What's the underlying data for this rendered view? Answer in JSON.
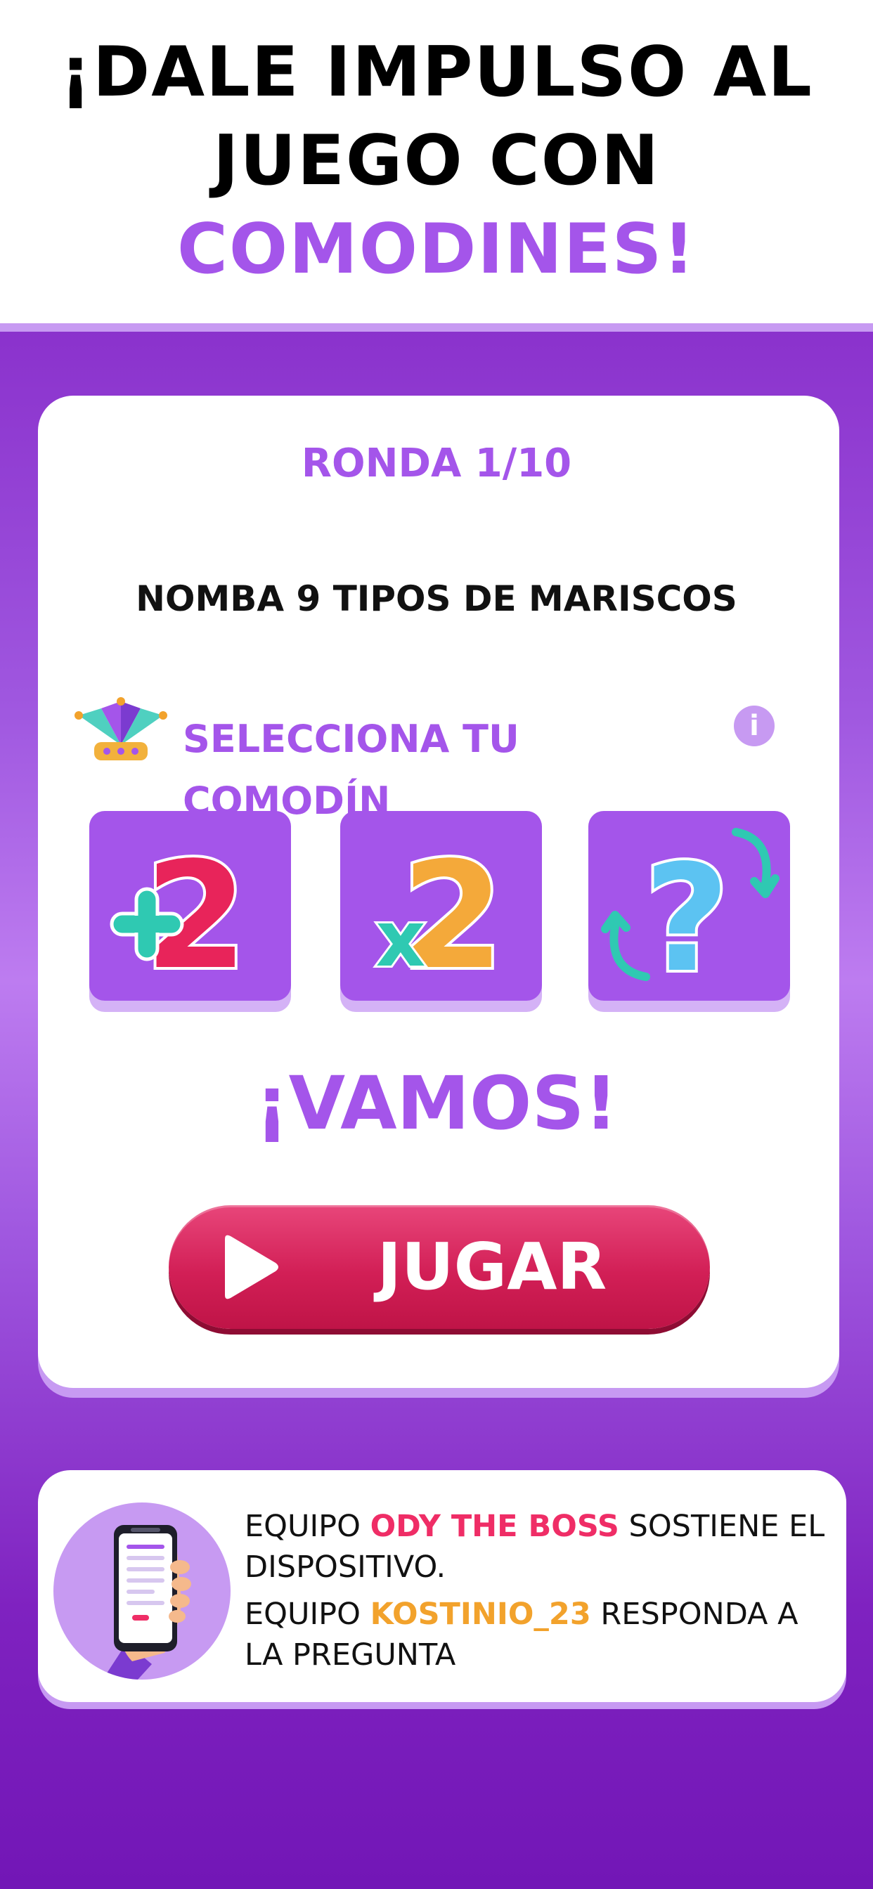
{
  "headline": {
    "line1": "¡DALE IMPULSO AL",
    "line2": "JUEGO CON",
    "line3": "COMODINES!"
  },
  "round": {
    "label": "RONDA 1/10",
    "current": 1,
    "total": 10
  },
  "question": "NOMBA 9 TIPOS DE MARISCOS",
  "jokers": {
    "title": "SELECCIONA TU COMODÍN",
    "info_icon": "i",
    "items": [
      {
        "icon": "plus-two-icon",
        "label": "+2"
      },
      {
        "icon": "times-two-icon",
        "label": "x2"
      },
      {
        "icon": "swap-question-icon",
        "label": "?"
      }
    ]
  },
  "cta": {
    "vamos": "¡VAMOS!",
    "play_label": "JUGAR"
  },
  "turn_info": {
    "line1_prefix": "EQUIPO ",
    "team1": "ODY THE BOSS",
    "line1_suffix": " SOSTIENE EL DISPOSITIVO.",
    "line2_prefix": "EQUIPO ",
    "team2": "KOSTINIO_23",
    "line2_suffix": " RESPONDA A LA PREGUNTA"
  },
  "colors": {
    "accent": "#a455ea",
    "play": "#d21f56",
    "team1": "#ef2d66",
    "team2": "#f2a22c",
    "stage_dark": "#7216b6"
  }
}
